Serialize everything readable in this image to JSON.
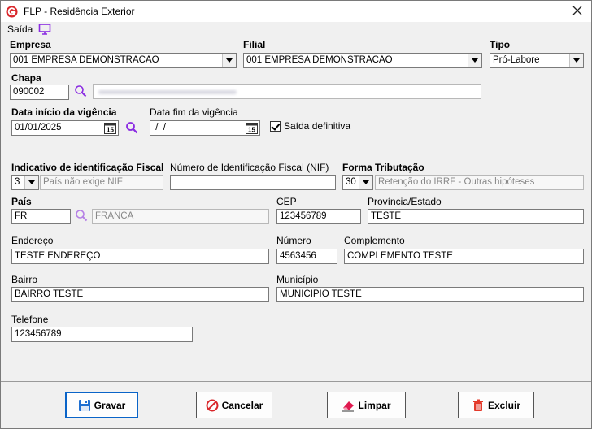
{
  "window": {
    "title": "FLP - Residência Exterior"
  },
  "menu": {
    "saida": "Saída"
  },
  "empresa": {
    "label": "Empresa",
    "value": "001 EMPRESA DEMONSTRACAO"
  },
  "filial": {
    "label": "Filial",
    "value": "001 EMPRESA DEMONSTRACAO"
  },
  "tipo": {
    "label": "Tipo",
    "value": "Pró-Labore"
  },
  "chapa": {
    "label": "Chapa",
    "value": "090002"
  },
  "vigencia": {
    "inicio_label": "Data início da vigência",
    "inicio_value": "01/01/2025",
    "fim_label": "Data fim da vigência",
    "fim_value": " /  /",
    "saida_definitiva": "Saída definitiva",
    "cal_day": "15"
  },
  "fiscal": {
    "indicativo_label": "Indicativo de identificação Fiscal",
    "indicativo_value": "3",
    "indicativo_desc": "País não exige NIF",
    "nif_label": "Número de Identificação Fiscal (NIF)",
    "nif_value": "",
    "forma_label": "Forma Tributação",
    "forma_value": "30",
    "forma_desc": "Retenção do IRRF - Outras hipóteses"
  },
  "pais": {
    "label": "País",
    "value": "FR",
    "desc": "FRANCA"
  },
  "cep": {
    "label": "CEP",
    "value": "123456789"
  },
  "provincia": {
    "label": "Província/Estado",
    "value": "TESTE"
  },
  "endereco": {
    "label": "Endereço",
    "value": "TESTE ENDEREÇO"
  },
  "numero": {
    "label": "Número",
    "value": "4563456"
  },
  "complemento": {
    "label": "Complemento",
    "value": "COMPLEMENTO TESTE"
  },
  "bairro": {
    "label": "Bairro",
    "value": "BAIRRO TESTE"
  },
  "municipio": {
    "label": "Município",
    "value": "MUNICIPIO TESTE"
  },
  "telefone": {
    "label": "Telefone",
    "value": "123456789"
  },
  "buttons": {
    "gravar": "Gravar",
    "cancelar": "Cancelar",
    "limpar": "Limpar",
    "excluir": "Excluir"
  },
  "colors": {
    "accent": "#0a64c8",
    "search": "#8a2be2",
    "cancel": "#d9262a",
    "eraser": "#e0194f",
    "delete": "#e33a2b"
  }
}
